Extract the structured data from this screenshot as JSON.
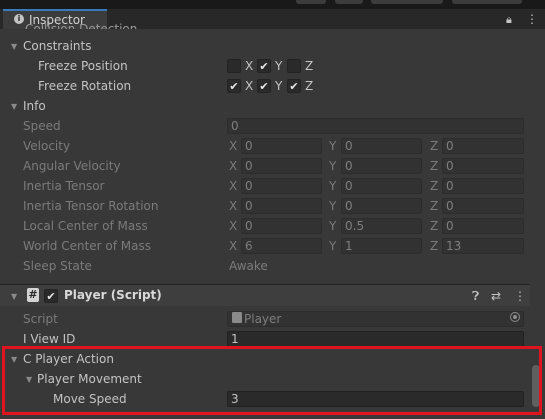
{
  "window": {
    "tab_title": "Inspector",
    "tab_icon": "info-icon",
    "lock_icon": "lock-icon",
    "menu_icon": "kebab-menu-icon",
    "cut_off_text": "Collision Detection"
  },
  "rigidbody": {
    "constraints": {
      "label": "Constraints",
      "freeze_position": {
        "label": "Freeze Position",
        "x": false,
        "y": true,
        "z": false,
        "x_label": "X",
        "y_label": "Y",
        "z_label": "Z"
      },
      "freeze_rotation": {
        "label": "Freeze Rotation",
        "x": true,
        "y": true,
        "z": true,
        "x_label": "X",
        "y_label": "Y",
        "z_label": "Z"
      }
    },
    "info": {
      "label": "Info",
      "speed": {
        "label": "Speed",
        "value": "0"
      },
      "velocity": {
        "label": "Velocity",
        "x": "0",
        "y": "0",
        "z": "0"
      },
      "angular_velocity": {
        "label": "Angular Velocity",
        "x": "0",
        "y": "0",
        "z": "0"
      },
      "inertia_tensor": {
        "label": "Inertia Tensor",
        "x": "0",
        "y": "0",
        "z": "0"
      },
      "inertia_tensor_rotation": {
        "label": "Inertia Tensor Rotation",
        "x": "0",
        "y": "0",
        "z": "0"
      },
      "local_center_of_mass": {
        "label": "Local Center of Mass",
        "x": "0",
        "y": "0.5",
        "z": "0"
      },
      "world_center_of_mass": {
        "label": "World Center of Mass",
        "x": "6",
        "y": "1",
        "z": "13"
      },
      "sleep_state": {
        "label": "Sleep State",
        "value": "Awake"
      },
      "axis_labels": {
        "x": "X",
        "y": "Y",
        "z": "Z"
      }
    }
  },
  "player_script": {
    "title": "Player (Script)",
    "enabled": true,
    "header_icons": [
      "help-icon",
      "presets-icon",
      "kebab-menu-icon"
    ],
    "script": {
      "label": "Script",
      "value": "Player"
    },
    "view_id": {
      "label": "I View ID",
      "value": "1"
    },
    "player_action": {
      "label": "C Player Action",
      "player_movement": {
        "label": "Player Movement",
        "move_speed": {
          "label": "Move Speed",
          "value": "3"
        }
      }
    }
  },
  "colors": {
    "background": "#383838",
    "field": "#2a2a2a",
    "tab_accent": "#3a79bb",
    "highlight_box": "#e0141e"
  }
}
